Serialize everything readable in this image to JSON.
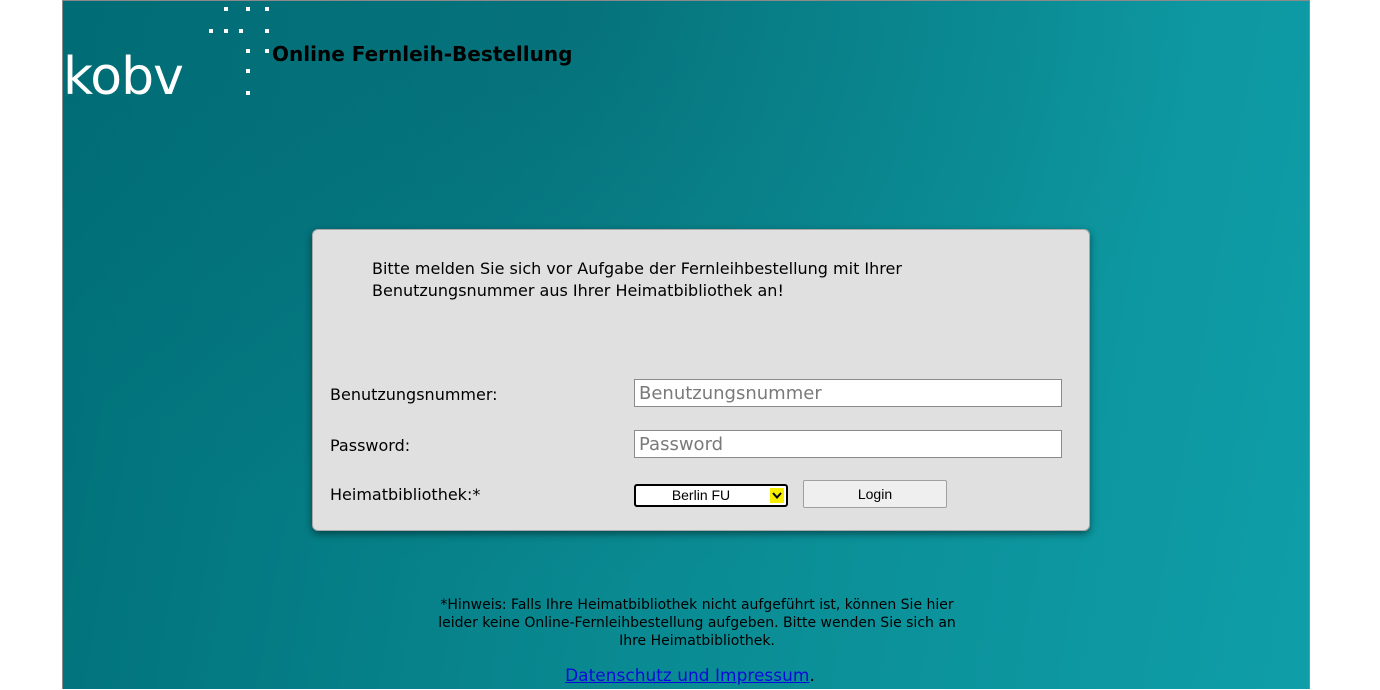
{
  "header": {
    "logo_text": "kobv",
    "title": "Online Fernleih-Bestellung"
  },
  "login": {
    "intro": "Bitte melden Sie sich vor Aufgabe der Fernleihbestellung mit Ihrer Benutzungsnummer aus Ihrer Heimatbibliothek an!",
    "user_label": "Benutzungsnummer:",
    "user_placeholder": "Benutzungsnummer",
    "password_label": "Password:",
    "password_placeholder": "Password",
    "library_label": "Heimatbibliothek:*",
    "library_selected": "Berlin FU",
    "login_button": "Login"
  },
  "hint": "*Hinweis: Falls Ihre Heimatbibliothek nicht aufgeführt ist, können Sie hier leider keine Online-Fernleihbestellung aufgeben. Bitte wenden Sie sich an Ihre Heimatbibliothek.",
  "footer": {
    "link_text": "Datenschutz und Impressum",
    "suffix": "."
  },
  "colors": {
    "background_teal": "#0a8a92",
    "panel": "#e0e0e0",
    "select_arrow": "#f5ee00",
    "link": "#0b0bd9"
  }
}
